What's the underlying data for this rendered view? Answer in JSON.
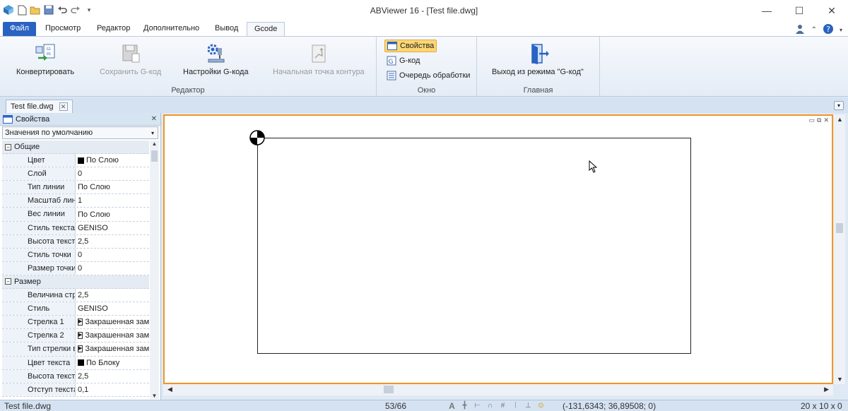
{
  "window": {
    "title": "ABViewer 16 - [Test file.dwg]",
    "minimize": "—",
    "maximize": "☐",
    "close": "✕"
  },
  "ribbon_tabs": [
    "Файл",
    "Просмотр",
    "Редактор",
    "Дополнительно",
    "Вывод",
    "Gcode"
  ],
  "active_tab": "Gcode",
  "ribbon": {
    "editor_group": {
      "label": "Редактор",
      "convert": "Конвертировать",
      "save_gcode": "Сохранить G-код",
      "gcode_settings": "Настройки G-кода",
      "contour_start": "Начальная точка контура"
    },
    "window_group": {
      "label": "Окно",
      "properties": "Свойства",
      "gcode": "G-код",
      "queue": "Очередь обработки"
    },
    "main_group": {
      "label": "Главная",
      "exit_gcode": "Выход из режима \"G-код\""
    }
  },
  "doc_tab": "Test file.dwg",
  "properties_panel": {
    "title": "Свойства",
    "combo_value": "Значения по умолчанию",
    "rows": [
      {
        "type": "cat",
        "name": "Общие"
      },
      {
        "name": "Цвет",
        "value": "По Слою",
        "icon": "swatch"
      },
      {
        "name": "Слой",
        "value": "0"
      },
      {
        "name": "Тип линии",
        "value": "По Слою"
      },
      {
        "name": "Масштаб линии",
        "value": "1"
      },
      {
        "name": "Вес линии",
        "value": "По Слою"
      },
      {
        "name": "Стиль текста",
        "value": "GENISO"
      },
      {
        "name": "Высота текста",
        "value": "2,5"
      },
      {
        "name": "Стиль точки",
        "value": "0"
      },
      {
        "name": "Размер точки",
        "value": "0"
      },
      {
        "type": "cat",
        "name": "Размер"
      },
      {
        "name": "Величина стрелки",
        "value": "2,5"
      },
      {
        "name": "Стиль",
        "value": "GENISO"
      },
      {
        "name": "Стрелка 1",
        "value": "Закрашенная замкнутая",
        "icon": "arrow"
      },
      {
        "name": "Стрелка 2",
        "value": "Закрашенная замкнутая",
        "icon": "arrow"
      },
      {
        "name": "Тип стрелки выноски",
        "value": "Закрашенная замкнутая",
        "icon": "arrow"
      },
      {
        "name": "Цвет текста",
        "value": "По Блоку",
        "icon": "swatch"
      },
      {
        "name": "Высота текста",
        "value": "2,5"
      },
      {
        "name": "Отступ текста",
        "value": "0,1"
      }
    ]
  },
  "status_bar": {
    "file": "Test file.dwg",
    "page": "53/66",
    "coords": "(-131,6343; 36,89508; 0)",
    "size": "20 x 10 x 0"
  },
  "colors": {
    "accent": "#2a62c2",
    "canvas_border": "#f29522",
    "checked": "#fbd774"
  }
}
